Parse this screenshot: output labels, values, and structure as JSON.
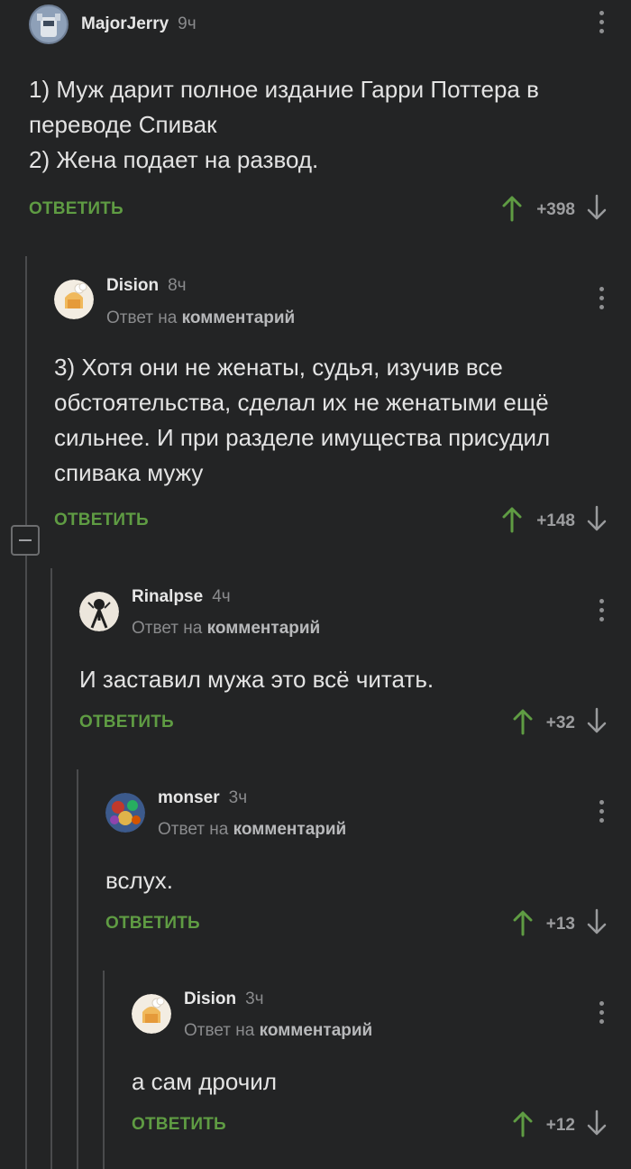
{
  "comments": [
    {
      "author": "MajorJerry",
      "time": "9ч",
      "reply_prefix": "",
      "reply_target": "",
      "text_lines": [
        "1) Муж дарит полное издание Гарри Поттера в",
        "переводе Спивак",
        "2) Жена подает на развод."
      ],
      "reply_label": "ОТВЕТИТЬ",
      "rating": "+398"
    },
    {
      "author": "Dision",
      "time": "8ч",
      "reply_prefix": "Ответ на",
      "reply_target": "комментарий",
      "text_lines": [
        "3) Хотя они не женаты, судья, изучив все",
        "обстоятельства, сделал их не женатыми ещё",
        "сильнее. И при разделе имущества присудил",
        "спивака мужу"
      ],
      "reply_label": "ОТВЕТИТЬ",
      "rating": "+148"
    },
    {
      "author": "Rinalpse",
      "time": "4ч",
      "reply_prefix": "Ответ на",
      "reply_target": "комментарий",
      "text_lines": [
        "И заставил мужа это всё читать."
      ],
      "reply_label": "ОТВЕТИТЬ",
      "rating": "+32"
    },
    {
      "author": "monser",
      "time": "3ч",
      "reply_prefix": "Ответ на",
      "reply_target": "комментарий",
      "text_lines": [
        "вслух."
      ],
      "reply_label": "ОТВЕТИТЬ",
      "rating": "+13"
    },
    {
      "author": "Dision",
      "time": "3ч",
      "reply_prefix": "Ответ на",
      "reply_target": "комментарий",
      "text_lines": [
        "а сам дрочил"
      ],
      "reply_label": "ОТВЕТИТЬ",
      "rating": "+12"
    }
  ],
  "icons": {
    "vote_up": "arrow-up-icon",
    "vote_down": "arrow-down-icon",
    "more": "more-vertical-icon",
    "collapse": "minus-icon"
  },
  "colors": {
    "background": "#232425",
    "accent_green": "#5f9c43",
    "muted_text": "#8a8b8d",
    "thread_line": "#4a4b4d"
  }
}
